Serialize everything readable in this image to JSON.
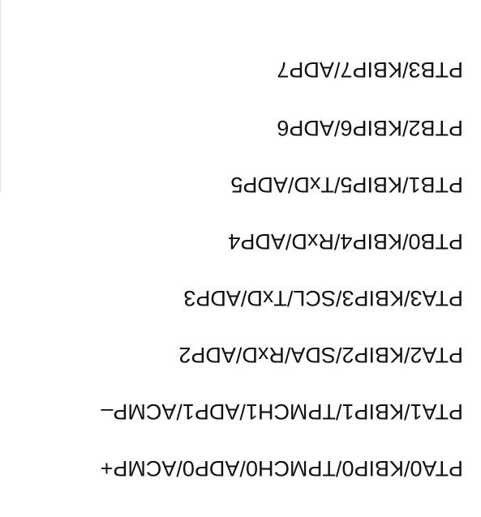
{
  "pins": [
    {
      "label": "PTA0/KBIP0/TPMCH0/ADP0/ACMP+"
    },
    {
      "label": "PTA1/KBIP1/TPMCH1/ADP1/ACMP–"
    },
    {
      "label": "PTA2/KBIP2/SDA/RxD/ADP2"
    },
    {
      "label": "PTA3/KBIP3/SCL/TxD/ADP3"
    },
    {
      "label": "PTB0/KBIP4/RxD/ADP4"
    },
    {
      "label": "PTB1/KBIP5/TxD/ADP5"
    },
    {
      "label": "PTB2/KBIP6/ADP6"
    },
    {
      "label": "PTB3/KBIP7/ADP7"
    }
  ]
}
